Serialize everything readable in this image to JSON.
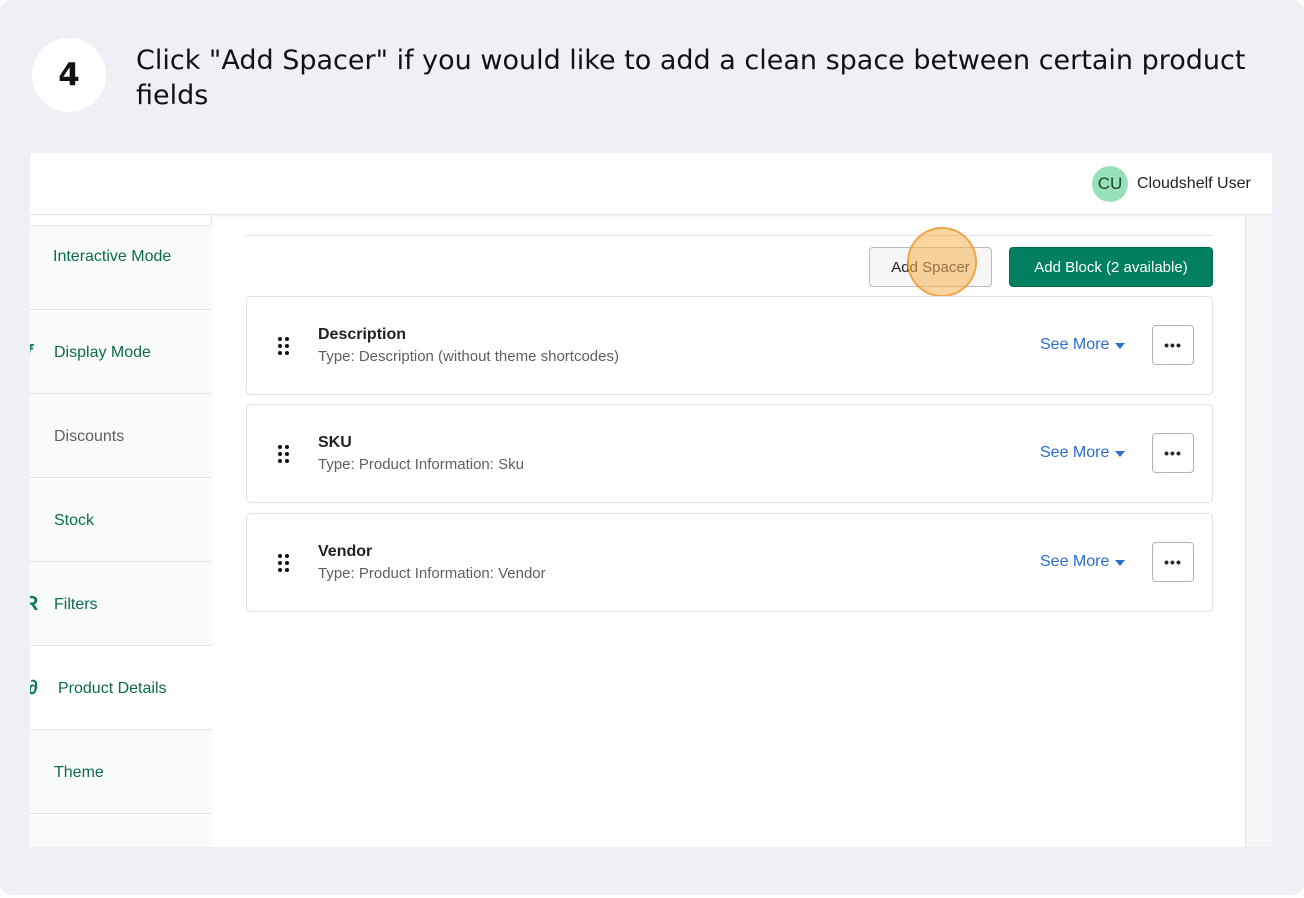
{
  "guide": {
    "step_number": "4",
    "instruction": "Click \"Add Spacer\" if you would like to add a clean space between certain product fields"
  },
  "header": {
    "avatar_initials": "CU",
    "user_name": "Cloudshelf User",
    "avatar_color": "#98e0b7"
  },
  "sidebar": {
    "items": [
      {
        "label": "Interactive Mode",
        "icon": "interactive-icon",
        "enabled": true
      },
      {
        "label": "Display Mode",
        "icon": "display-icon",
        "enabled": true
      },
      {
        "label": "Discounts",
        "icon": "discount-icon",
        "enabled": false
      },
      {
        "label": "Stock",
        "icon": "stock-icon",
        "enabled": true
      },
      {
        "label": "Filters",
        "icon": "filter-icon",
        "enabled": true
      },
      {
        "label": "Product Details",
        "icon": "product-details-icon",
        "enabled": true,
        "active": true
      },
      {
        "label": "Theme",
        "icon": "theme-icon",
        "enabled": true
      }
    ]
  },
  "toolbar": {
    "add_spacer_label": "Add Spacer",
    "add_block_label": "Add Block (2 available)",
    "primary_color": "#008060"
  },
  "blocks": [
    {
      "title": "Description",
      "type": "Type: Description (without theme shortcodes)",
      "see_more": "See More",
      "more_glyph": "•••"
    },
    {
      "title": "SKU",
      "type": "Type: Product Information: Sku",
      "see_more": "See More",
      "more_glyph": "•••"
    },
    {
      "title": "Vendor",
      "type": "Type: Product Information: Vendor",
      "see_more": "See More",
      "more_glyph": "•••"
    }
  ]
}
